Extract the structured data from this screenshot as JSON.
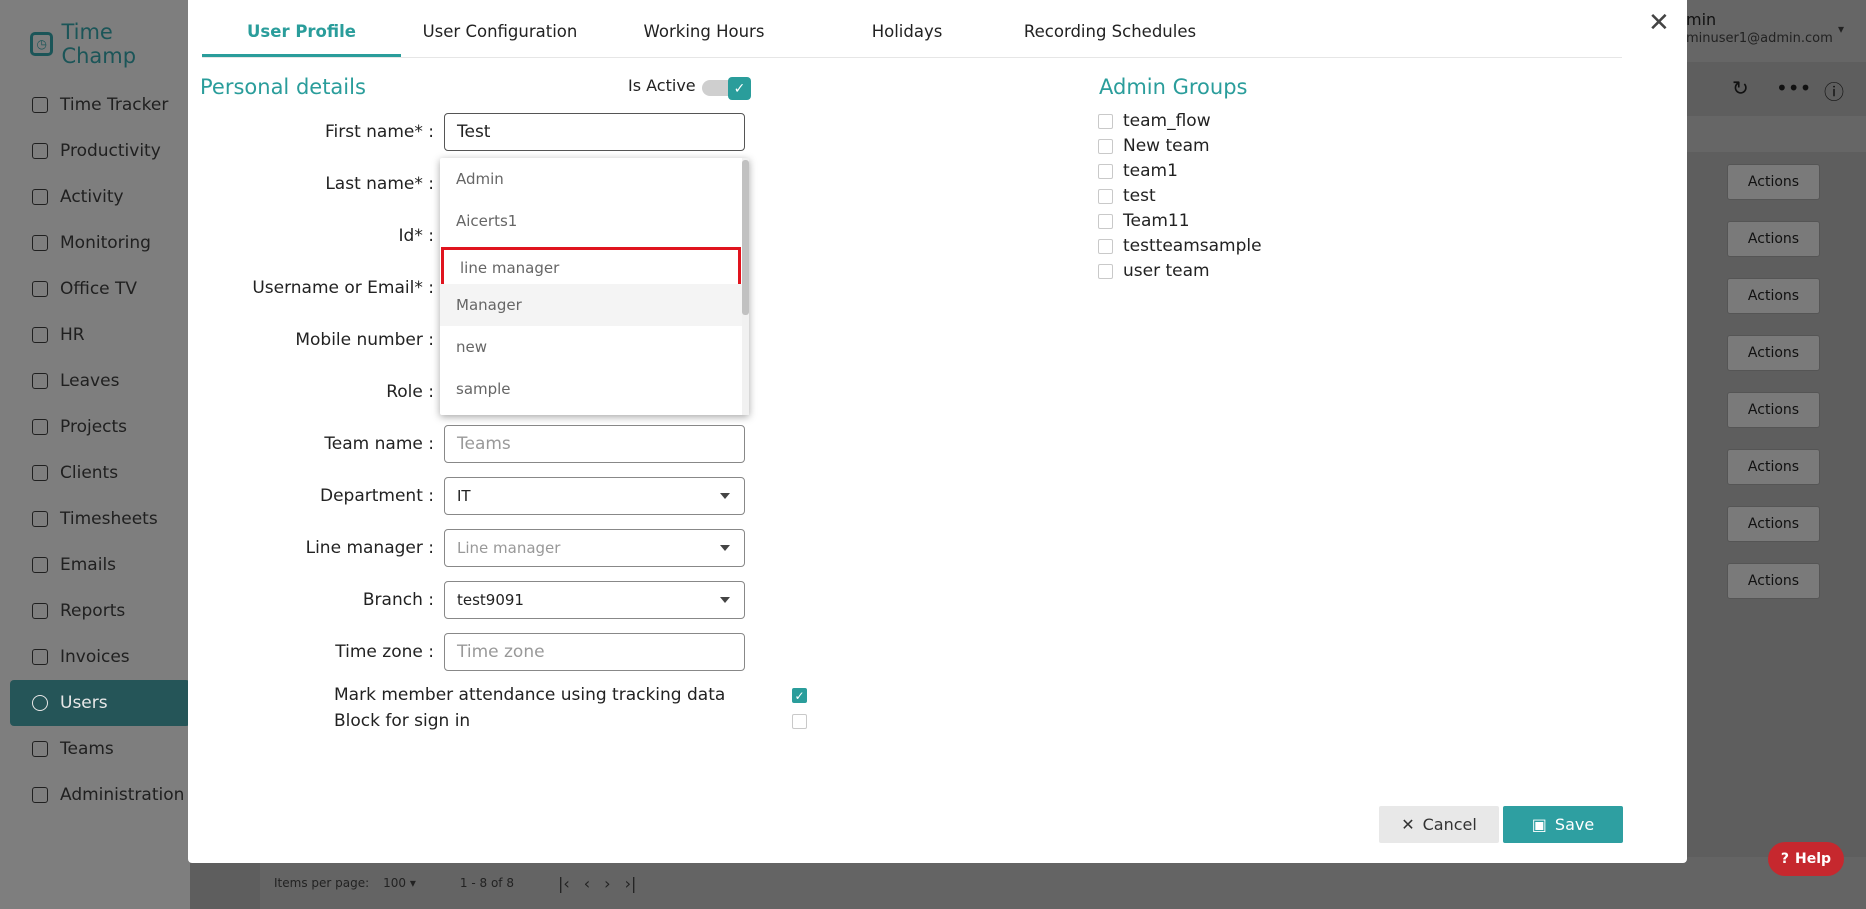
{
  "app": {
    "logo_text": "Time Champ",
    "user_name": "min",
    "user_email": "minuser1@admin.com",
    "nav": [
      {
        "label": "Time Tracker",
        "icon": "time-tracker-icon"
      },
      {
        "label": "Productivity",
        "icon": "productivity-icon"
      },
      {
        "label": "Activity",
        "icon": "activity-icon"
      },
      {
        "label": "Monitoring",
        "icon": "monitor-icon"
      },
      {
        "label": "Office TV",
        "icon": "tv-icon"
      },
      {
        "label": "HR",
        "icon": "hr-icon"
      },
      {
        "label": "Leaves",
        "icon": "calendar-icon"
      },
      {
        "label": "Projects",
        "icon": "briefcase-icon"
      },
      {
        "label": "Clients",
        "icon": "clients-icon"
      },
      {
        "label": "Timesheets",
        "icon": "clock-icon"
      },
      {
        "label": "Emails",
        "icon": "mail-icon"
      },
      {
        "label": "Reports",
        "icon": "pie-chart-icon"
      },
      {
        "label": "Invoices",
        "icon": "invoice-icon"
      },
      {
        "label": "Users",
        "icon": "users-icon",
        "active": true
      },
      {
        "label": "Teams",
        "icon": "teams-icon"
      },
      {
        "label": "Administration",
        "icon": "settings-icon"
      }
    ],
    "actions_label": "Actions",
    "footer": {
      "items_per_page_label": "Items per page:",
      "items_per_page_value": "100",
      "range": "1 - 8 of 8"
    },
    "help_label": "Help"
  },
  "modal": {
    "tabs": [
      "User Profile",
      "User Configuration",
      "Working Hours",
      "Holidays",
      "Recording Schedules"
    ],
    "active_tab": "User Profile",
    "personal_title": "Personal details",
    "is_active_label": "Is Active",
    "is_active": true,
    "fields": {
      "first_name": {
        "label": "First name*",
        "value": "Test"
      },
      "last_name": {
        "label": "Last name*"
      },
      "id": {
        "label": "Id*"
      },
      "username": {
        "label": "Username or Email*"
      },
      "mobile": {
        "label": "Mobile number"
      },
      "role": {
        "label": "Role"
      },
      "team_name": {
        "label": "Team name",
        "placeholder": "Teams"
      },
      "department": {
        "label": "Department",
        "value": "IT"
      },
      "line_manager": {
        "label": "Line manager",
        "placeholder": "Line manager"
      },
      "branch": {
        "label": "Branch",
        "value": "test9091"
      },
      "time_zone": {
        "label": "Time zone",
        "placeholder": "Time zone"
      }
    },
    "colon": ":",
    "role_options": [
      "Admin",
      "Aicerts1",
      "line manager",
      "Manager",
      "new",
      "sample"
    ],
    "highlighted_option": "line manager",
    "hovered_option": "Manager",
    "admin_groups_title": "Admin Groups",
    "admin_groups": [
      "team_flow",
      "New team",
      "team1",
      "test",
      "Team11",
      "testteamsample",
      "user team"
    ],
    "mark_attendance_label": "Mark member attendance using tracking data",
    "mark_attendance": true,
    "block_signin_label": "Block for sign in",
    "block_signin": false,
    "cancel_label": "Cancel",
    "save_label": "Save"
  },
  "colors": {
    "accent": "#2a9d9b",
    "highlight_border": "#e0141e",
    "help": "#c6282e"
  }
}
